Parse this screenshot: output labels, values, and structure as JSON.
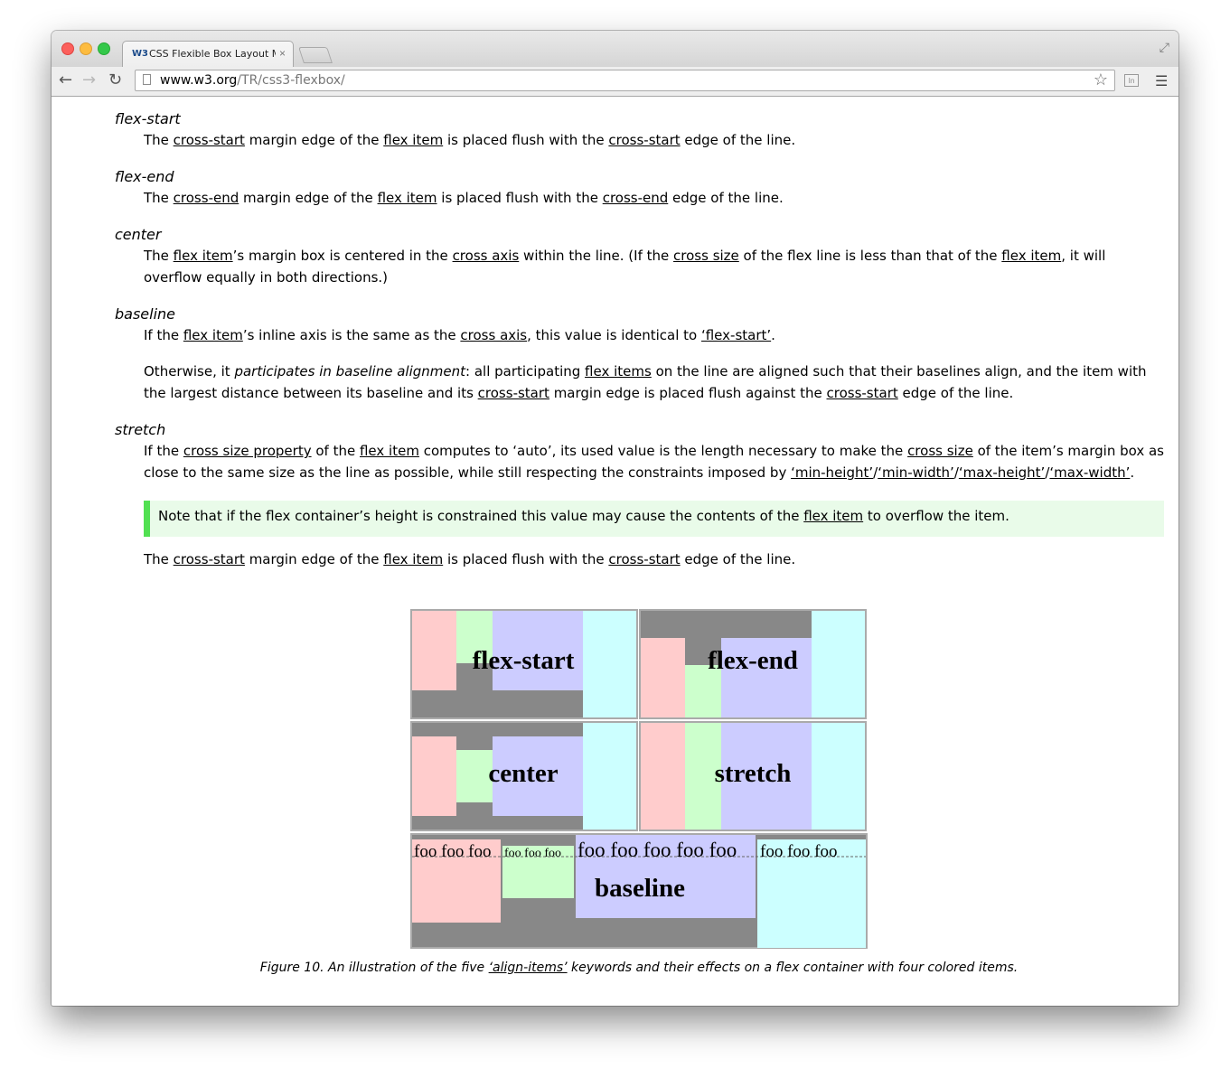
{
  "browser": {
    "tab_favicon": "W3",
    "tab_title": "CSS Flexible Box Layout Module",
    "tab_close": "×",
    "url_host": "www.w3.org",
    "url_path": "/TR/css3-flexbox/"
  },
  "page": {
    "flex_start": {
      "term": "flex-start",
      "s1": "The ",
      "l1": "cross-start",
      "s2": " margin edge of the ",
      "l2": "flex item",
      "s3": " is placed flush with the ",
      "l3": "cross-start",
      "s4": " edge of the line."
    },
    "flex_end": {
      "term": "flex-end",
      "s1": "The ",
      "l1": "cross-end",
      "s2": " margin edge of the ",
      "l2": "flex item",
      "s3": " is placed flush with the ",
      "l3": "cross-end",
      "s4": " edge of the line."
    },
    "center": {
      "term": "center",
      "s1": "The ",
      "l1": "flex item",
      "s2": "’s margin box is centered in the ",
      "l2": "cross axis",
      "s3": " within the line.  (If the ",
      "l3": "cross size",
      "s4": " of the flex line is less than that of the ",
      "l4": "flex item",
      "s5": ", it will overflow equally in both directions.)"
    },
    "baseline": {
      "term": "baseline",
      "p1_s1": "If the ",
      "p1_l1": "flex item",
      "p1_s2": "’s inline axis is the same as the ",
      "p1_l2": "cross axis",
      "p1_s3": ", this value is identical to ",
      "p1_l3": "‘flex-start’",
      "p1_s4": ".",
      "p2_s1": "Otherwise, it ",
      "p2_em": "participates in baseline alignment",
      "p2_s2": ": all participating ",
      "p2_l1": "flex items",
      "p2_s3": " on the line are aligned such that their baselines align, and the item with the largest distance between its baseline and its ",
      "p2_l2": "cross-start",
      "p2_s4": " margin edge is placed flush against the ",
      "p2_l3": "cross-start",
      "p2_s5": " edge of the line."
    },
    "stretch": {
      "term": "stretch",
      "s1": "If the ",
      "l1": "cross size property",
      "s2": " of the ",
      "l2": "flex item",
      "s3": " computes to ‘auto’, its used value is the length necessary to make the ",
      "l3": "cross size",
      "s4": " of the item’s margin box as close to the same size as the line as possible, while still respecting the constraints imposed by ",
      "l4": "‘min-height’",
      "sep1": "/",
      "l5": "‘min-width’",
      "sep2": "/",
      "l6": "‘max-height’",
      "sep3": "/",
      "l7": "‘max-width’",
      "s5": ".",
      "note_s1": "Note that if the flex container’s height is constrained this value may cause the contents of the ",
      "note_l1": "flex item",
      "note_s2": " to overflow the item.",
      "p3_s1": "The ",
      "p3_l1": "cross-start",
      "p3_s2": " margin edge of the ",
      "p3_l2": "flex item",
      "p3_s3": " is placed flush with the ",
      "p3_l3": "cross-start",
      "p3_s4": " edge of the line."
    },
    "figure": {
      "label_flex_start": "flex-start",
      "label_flex_end": "flex-end",
      "label_center": "center",
      "label_stretch": "stretch",
      "label_baseline": "baseline",
      "foo3": "foo foo foo",
      "foo5": "foo foo foo foo foo",
      "colors": {
        "container": "#888888",
        "red": "#ffcccc",
        "green": "#ccffcc",
        "blue": "#ccccff",
        "cyan": "#ccffff"
      },
      "caption_s1": "Figure 10.  An illustration of the five ",
      "caption_l1": "‘align-items’",
      "caption_s2": " keywords and their effects on a flex container with four colored items."
    }
  }
}
